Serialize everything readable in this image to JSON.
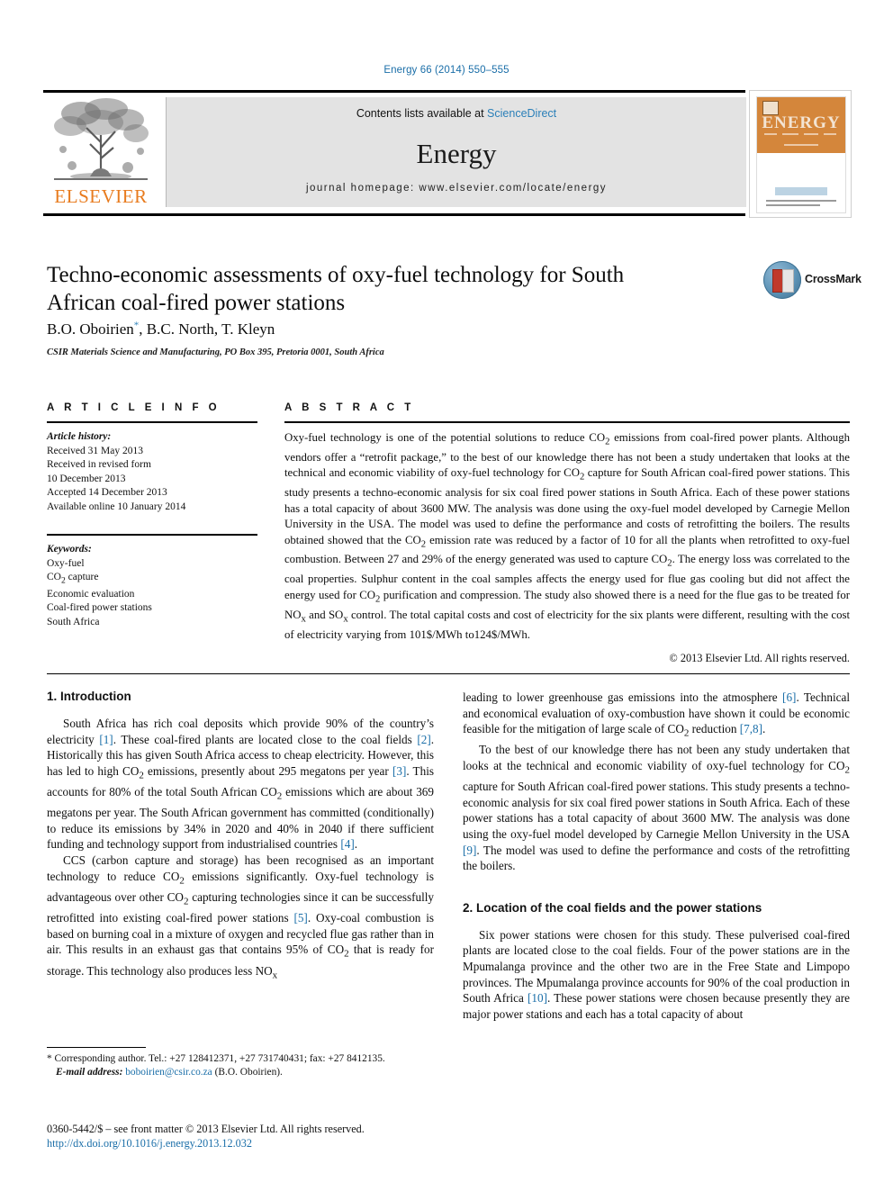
{
  "running_head": "Energy 66 (2014) 550–555",
  "masthead": {
    "contents_prefix": "Contents lists available at ",
    "sciencedirect": "ScienceDirect",
    "journal_name": "Energy",
    "homepage": "journal homepage: www.elsevier.com/locate/energy",
    "publisher_logo_text": "ELSEVIER",
    "cover_title": "ENERGY",
    "accent_orange": "#E87B1E",
    "accent_blue": "#1a6ea8"
  },
  "article": {
    "title": "Techno-economic assessments of oxy-fuel technology for South African coal-fired power stations",
    "authors": "B.O. Oboirien, B.C. North, T. Kleyn",
    "corresponding_marker": "*",
    "affiliation": "CSIR Materials Science and Manufacturing, PO Box 395, Pretoria 0001, South Africa",
    "crossmark_label": "CrossMark"
  },
  "article_info": {
    "heading": "A R T I C L E   I N F O",
    "history_label": "Article history:",
    "history": [
      "Received 31 May 2013",
      "Received in revised form",
      "10 December 2013",
      "Accepted 14 December 2013",
      "Available online 10 January 2014"
    ],
    "keywords_label": "Keywords:",
    "keywords": [
      "Oxy-fuel",
      "CO2 capture",
      "Economic evaluation",
      "Coal-fired power stations",
      "South Africa"
    ]
  },
  "abstract": {
    "heading": "A B S T R A C T",
    "text": "Oxy-fuel technology is one of the potential solutions to reduce CO2 emissions from coal-fired power plants. Although vendors offer a “retrofit package,” to the best of our knowledge there has not been a study undertaken that looks at the technical and economic viability of oxy-fuel technology for CO2 capture for South African coal-fired power stations. This study presents a techno-economic analysis for six coal fired power stations in South Africa. Each of these power stations has a total capacity of about 3600 MW. The analysis was done using the oxy-fuel model developed by Carnegie Mellon University in the USA. The model was used to define the performance and costs of retrofitting the boilers. The results obtained showed that the CO2 emission rate was reduced by a factor of 10 for all the plants when retrofitted to oxy-fuel combustion. Between 27 and 29% of the energy generated was used to capture CO2. The energy loss was correlated to the coal properties. Sulphur content in the coal samples affects the energy used for flue gas cooling but did not affect the energy used for CO2 purification and compression. The study also showed there is a need for the flue gas to be treated for NOx and SOx control. The total capital costs and cost of electricity for the six plants were different, resulting with the cost of electricity varying from 101$/MWh to124$/MWh.",
    "copyright": "© 2013 Elsevier Ltd. All rights reserved."
  },
  "sections": {
    "intro_heading": "1. Introduction",
    "intro_p1": "South Africa has rich coal deposits which provide 90% of the country’s electricity [1]. These coal-fired plants are located close to the coal fields [2]. Historically this has given South Africa access to cheap electricity. However, this has led to high CO2 emissions, presently about 295 megatons per year [3]. This accounts for 80% of the total South African CO2 emissions which are about 369 megatons per year. The South African government has committed (conditionally) to reduce its emissions by 34% in 2020 and 40% in 2040 if there sufficient funding and technology support from industrialised countries [4].",
    "intro_p2": "CCS (carbon capture and storage) has been recognised as an important technology to reduce CO2 emissions significantly. Oxy-fuel technology is advantageous over other CO2 capturing technologies since it can be successfully retrofitted into existing coal-fired power stations [5]. Oxy-coal combustion is based on burning coal in a mixture of oxygen and recycled flue gas rather than in air. This results in an exhaust gas that contains 95% of CO2 that is ready for storage. This technology also produces less NOx",
    "intro_p3": "leading to lower greenhouse gas emissions into the atmosphere [6]. Technical and economical evaluation of oxy-combustion have shown it could be economic feasible for the mitigation of large scale of CO2 reduction [7,8].",
    "intro_p4": "To the best of our knowledge there has not been any study undertaken that looks at the technical and economic viability of oxy-fuel technology for CO2 capture for South African coal-fired power stations. This study presents a techno-economic analysis for six coal fired power stations in South Africa. Each of these power stations has a total capacity of about 3600 MW. The analysis was done using the oxy-fuel model developed by Carnegie Mellon University in the USA [9]. The model was used to define the performance and costs of the retrofitting the boilers.",
    "location_heading": "2. Location of the coal fields and the power stations",
    "location_p1": "Six power stations were chosen for this study. These pulverised coal-fired plants are located close to the coal fields. Four of the power stations are in the Mpumalanga province and the other two are in the Free State and Limpopo provinces. The Mpumalanga province accounts for 90% of the coal production in South Africa [10]. These power stations were chosen because presently they are major power stations and each has a total capacity of about"
  },
  "footnote": {
    "corresponding": "* Corresponding author. Tel.: +27 128412371, +27 731740431; fax: +27 8412135.",
    "email_label": "E-mail address:",
    "email": "boboirien@csir.co.za",
    "email_owner": "(B.O. Oboirien)."
  },
  "imprint": {
    "line1": "0360-5442/$ – see front matter © 2013 Elsevier Ltd. All rights reserved.",
    "doi": "http://dx.doi.org/10.1016/j.energy.2013.12.032"
  }
}
